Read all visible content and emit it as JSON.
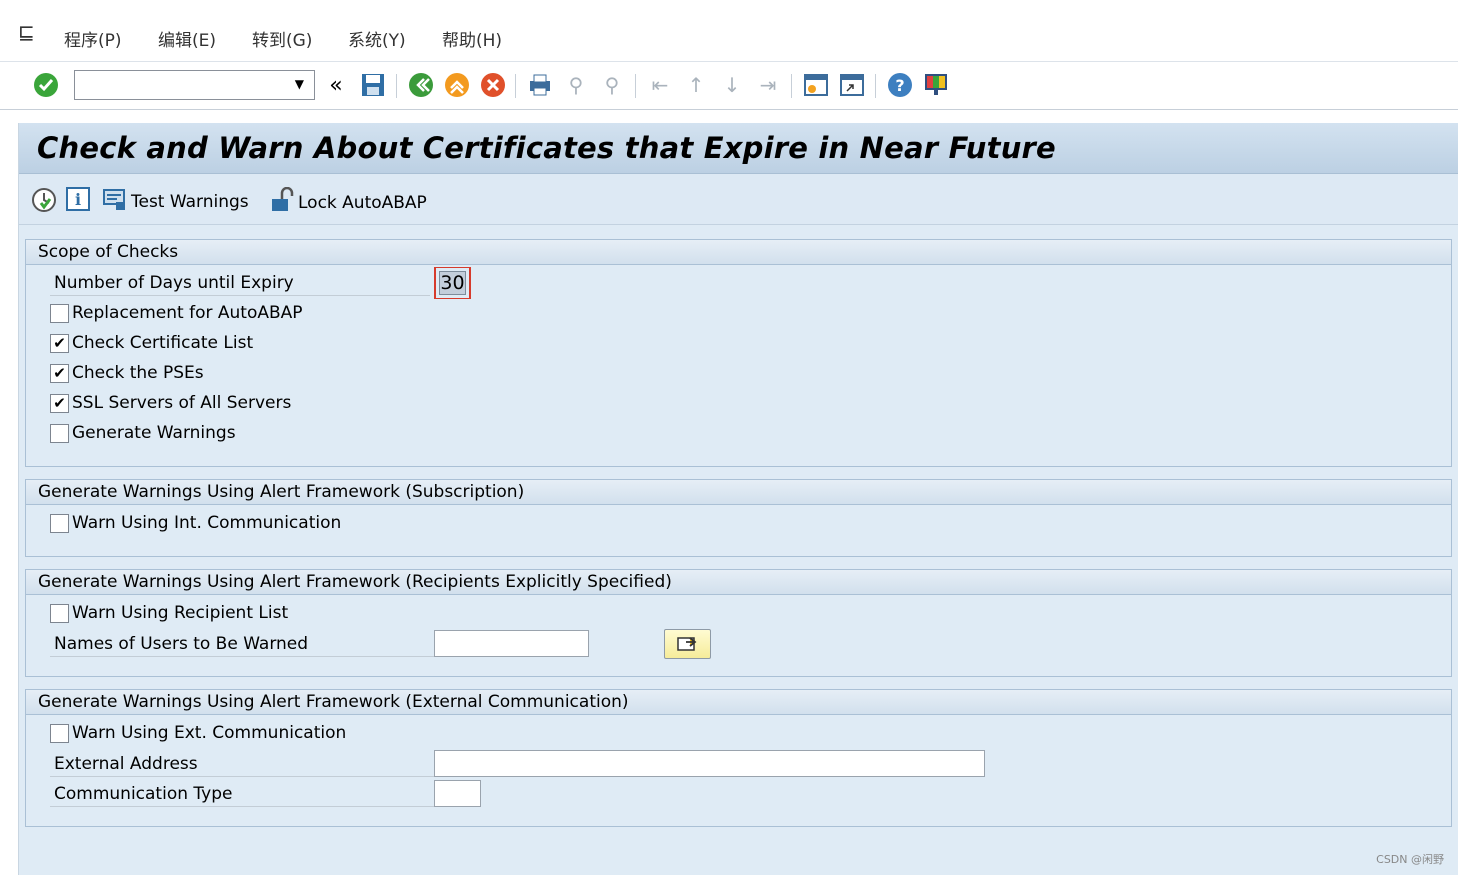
{
  "menu": {
    "items": [
      "程序(P)",
      "编辑(E)",
      "转到(G)",
      "系统(Y)",
      "帮助(H)"
    ]
  },
  "title": "Check and Warn About Certificates that Expire in Near Future",
  "app_toolbar": {
    "test_warnings": "Test Warnings",
    "lock_autoabap": "Lock AutoABAP"
  },
  "scope": {
    "heading": "Scope of Checks",
    "days_label": "Number of Days until Expiry",
    "days_value": "30",
    "replacement": "Replacement for AutoABAP",
    "check_cert_list": "Check Certificate List",
    "check_pses": "Check the PSEs",
    "ssl_servers": "SSL Servers of All Servers",
    "generate_warnings": "Generate Warnings"
  },
  "subscription": {
    "heading": "Generate Warnings Using Alert Framework (Subscription)",
    "warn_int": "Warn Using Int. Communication"
  },
  "recipients": {
    "heading": "Generate Warnings Using Alert Framework (Recipients Explicitly Specified)",
    "warn_recipient": "Warn Using Recipient List",
    "names_label": "Names of Users to Be Warned"
  },
  "external": {
    "heading": "Generate Warnings Using Alert Framework (External Communication)",
    "warn_ext": "Warn Using Ext. Communication",
    "address_label": "External Address",
    "comm_type_label": "Communication Type"
  },
  "checkbox_state": {
    "replacement": false,
    "check_cert_list": true,
    "check_pses": true,
    "ssl_servers": true,
    "generate_warnings": false,
    "warn_int": false,
    "warn_recipient": false,
    "warn_ext": false
  },
  "check_glyph": "✔",
  "watermark": "CSDN @闲野"
}
